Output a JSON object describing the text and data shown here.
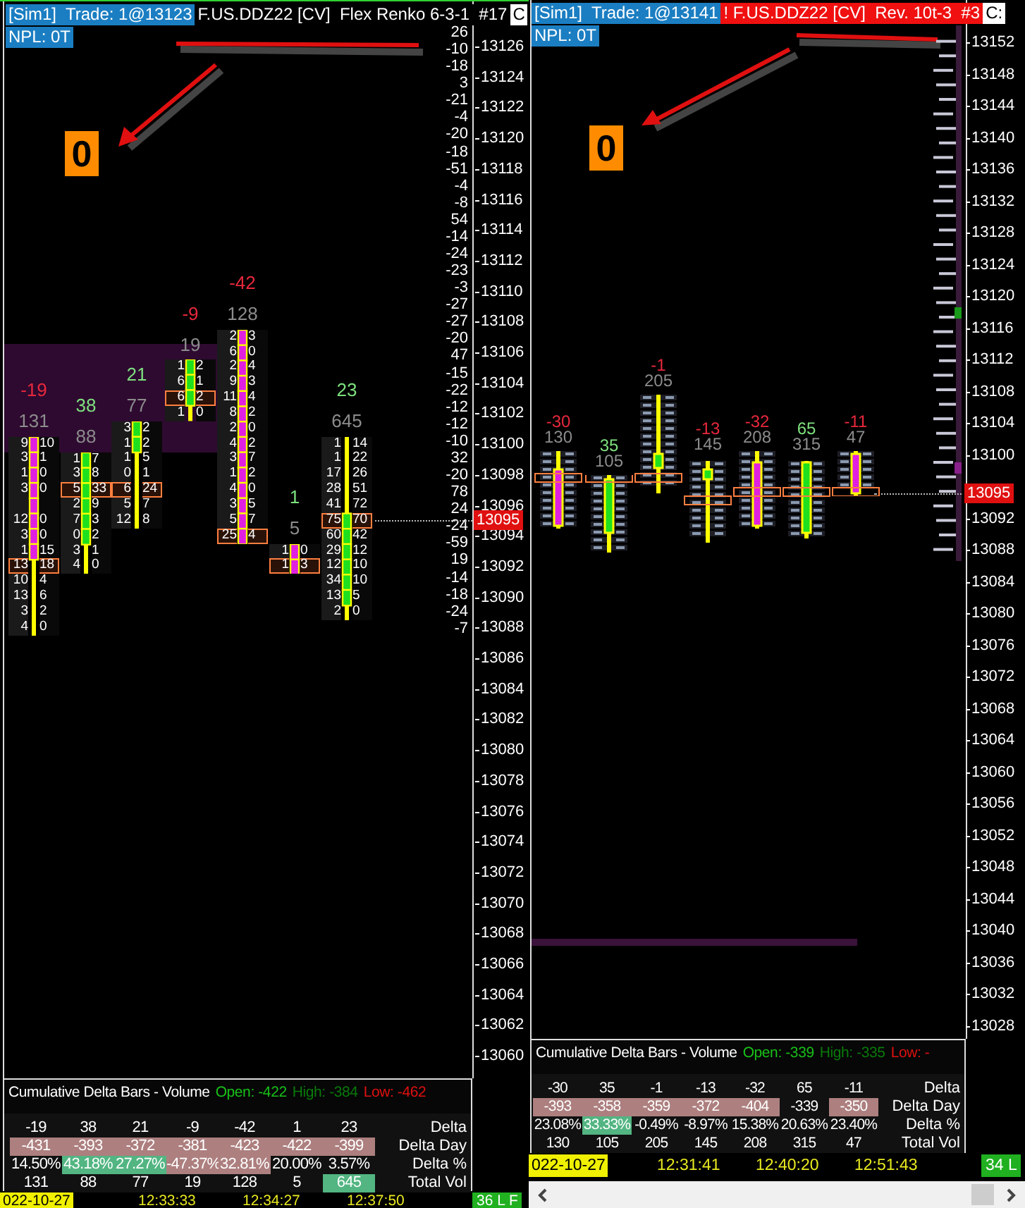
{
  "left": {
    "trade_info": "[Sim1]  Trade: 1@13123",
    "symbol": "F.US.DDZ22 [CV]  Flex Renko 6-3-1  #17",
    "symbol_alert": false,
    "corner": "C",
    "npl": "NPL: 0T",
    "marker": "0",
    "price_axis": [
      "13126",
      "13124",
      "13122",
      "13120",
      "13118",
      "13116",
      "13114",
      "13112",
      "13110",
      "13108",
      "13106",
      "13104",
      "13102",
      "13100",
      "13098",
      "13096",
      "13094",
      "13092",
      "13090",
      "13088",
      "13086",
      "13084",
      "13082",
      "13080",
      "13078",
      "13076",
      "13074",
      "13072",
      "13070",
      "13068",
      "13066",
      "13064",
      "13062",
      "13060"
    ],
    "delta_ladder": [
      "26",
      "-10",
      "-18",
      "3",
      "-21",
      "-4",
      "-20",
      "-18",
      "-51",
      "-4",
      "-8",
      "54",
      "-14",
      "-24",
      "-23",
      "-3",
      "-27",
      "-27",
      "-20",
      "47",
      "-15",
      "-22",
      "-12",
      "-12",
      "-10",
      "32",
      "-20",
      "78",
      "24",
      "-24",
      "-59",
      "19",
      "-14",
      "-18",
      "-24",
      "-7"
    ],
    "current_price": "13095",
    "bars": [
      {
        "delta": "-19",
        "negative": true,
        "volume": "131",
        "bullish": false,
        "rows": [
          {
            "bid": "9",
            "ask": "10",
            "poc": false,
            "body": true
          },
          {
            "bid": "3",
            "ask": "1",
            "poc": false,
            "body": true
          },
          {
            "bid": "1",
            "ask": "0",
            "poc": false,
            "body": true
          },
          {
            "bid": "3",
            "ask": "0",
            "poc": false,
            "body": true
          },
          {
            "poc": false,
            "body": true
          },
          {
            "bid": "12",
            "ask": "0",
            "poc": false,
            "body": true
          },
          {
            "bid": "3",
            "ask": "0",
            "poc": false,
            "body": true
          },
          {
            "bid": "1",
            "ask": "15",
            "poc": false,
            "body": true
          },
          {
            "bid": "13",
            "ask": "18",
            "poc": true,
            "body": false
          },
          {
            "bid": "10",
            "ask": "4",
            "poc": false,
            "body": false
          },
          {
            "bid": "13",
            "ask": "6",
            "poc": false,
            "body": false
          },
          {
            "bid": "3",
            "ask": "2",
            "poc": false,
            "body": false
          },
          {
            "bid": "4",
            "ask": "0",
            "poc": false,
            "body": false
          }
        ]
      },
      {
        "delta": "38",
        "negative": false,
        "volume": "88",
        "bullish": true,
        "rows": [
          {
            "bid": "1",
            "ask": "7",
            "poc": false,
            "body": true
          },
          {
            "bid": "3",
            "ask": "8",
            "poc": false,
            "body": true
          },
          {
            "bid": "5",
            "ask": "33",
            "poc": true,
            "body": true
          },
          {
            "bid": "2",
            "ask": "9",
            "poc": false,
            "body": true
          },
          {
            "bid": "7",
            "ask": "3",
            "poc": false,
            "body": true
          },
          {
            "bid": "0",
            "ask": "2",
            "poc": false,
            "body": true
          },
          {
            "bid": "3",
            "ask": "1",
            "poc": false,
            "body": false
          },
          {
            "bid": "4",
            "ask": "0",
            "poc": false,
            "body": false
          }
        ]
      },
      {
        "delta": "21",
        "negative": false,
        "volume": "77",
        "bullish": true,
        "rows": [
          {
            "bid": "3",
            "ask": "2",
            "poc": false,
            "body": true
          },
          {
            "bid": "1",
            "ask": "2",
            "poc": false,
            "body": true
          },
          {
            "bid": "1",
            "ask": "5",
            "poc": false,
            "body": false
          },
          {
            "bid": "0",
            "ask": "1",
            "poc": false,
            "body": false
          },
          {
            "bid": "6",
            "ask": "24",
            "poc": true,
            "body": false
          },
          {
            "bid": "5",
            "ask": "7",
            "poc": false,
            "body": false
          },
          {
            "bid": "12",
            "ask": "8",
            "poc": false,
            "body": false
          }
        ]
      },
      {
        "delta": "-9",
        "negative": true,
        "volume": "19",
        "bullish": true,
        "rows": [
          {
            "bid": "1",
            "ask": "2",
            "poc": false,
            "body": true
          },
          {
            "bid": "6",
            "ask": "1",
            "poc": false,
            "body": true
          },
          {
            "bid": "6",
            "ask": "2",
            "poc": true,
            "body": true
          },
          {
            "bid": "1",
            "ask": "0",
            "poc": false,
            "body": false
          }
        ]
      },
      {
        "delta": "-42",
        "negative": true,
        "volume": "128",
        "bullish": false,
        "rows": [
          {
            "bid": "2",
            "ask": "3",
            "poc": false,
            "body": true
          },
          {
            "bid": "6",
            "ask": "0",
            "poc": false,
            "body": true
          },
          {
            "bid": "2",
            "ask": "4",
            "poc": false,
            "body": true
          },
          {
            "bid": "9",
            "ask": "3",
            "poc": false,
            "body": true
          },
          {
            "bid": "11",
            "ask": "4",
            "poc": false,
            "body": true
          },
          {
            "bid": "8",
            "ask": "2",
            "poc": false,
            "body": true
          },
          {
            "bid": "2",
            "ask": "0",
            "poc": false,
            "body": true
          },
          {
            "bid": "4",
            "ask": "2",
            "poc": false,
            "body": true
          },
          {
            "bid": "3",
            "ask": "7",
            "poc": false,
            "body": true
          },
          {
            "bid": "1",
            "ask": "2",
            "poc": false,
            "body": true
          },
          {
            "bid": "4",
            "ask": "0",
            "poc": false,
            "body": true
          },
          {
            "bid": "3",
            "ask": "5",
            "poc": false,
            "body": true
          },
          {
            "bid": "5",
            "ask": "7",
            "poc": false,
            "body": true
          },
          {
            "bid": "25",
            "ask": "4",
            "poc": true,
            "body": true
          }
        ]
      },
      {
        "delta": "1",
        "negative": false,
        "volume": "5",
        "bullish": false,
        "rows": [
          {
            "bid": "1",
            "ask": "0",
            "poc": false,
            "body": true
          },
          {
            "bid": "1",
            "ask": "3",
            "poc": true,
            "body": true
          }
        ]
      },
      {
        "delta": "23",
        "negative": false,
        "volume": "645",
        "bullish": true,
        "rows": [
          {
            "bid": "1",
            "ask": "14",
            "poc": false,
            "body": false
          },
          {
            "bid": "1",
            "ask": "22",
            "poc": false,
            "body": false
          },
          {
            "bid": "17",
            "ask": "26",
            "poc": false,
            "body": false
          },
          {
            "bid": "28",
            "ask": "51",
            "poc": false,
            "body": false
          },
          {
            "bid": "41",
            "ask": "72",
            "poc": false,
            "body": false
          },
          {
            "bid": "75",
            "ask": "70",
            "poc": true,
            "body": true
          },
          {
            "bid": "60",
            "ask": "42",
            "poc": false,
            "body": true
          },
          {
            "bid": "29",
            "ask": "12",
            "poc": false,
            "body": true
          },
          {
            "bid": "12",
            "ask": "10",
            "poc": false,
            "body": true
          },
          {
            "bid": "34",
            "ask": "10",
            "poc": false,
            "body": true
          },
          {
            "bid": "13",
            "ask": "5",
            "poc": false,
            "body": true
          },
          {
            "bid": "2",
            "ask": "0",
            "poc": false,
            "body": false
          }
        ]
      }
    ],
    "indicator": {
      "title": "Cumulative Delta Bars - Volume",
      "open": "Open: -422",
      "high": "High: -384",
      "low": "Low: -462"
    },
    "table": [
      {
        "label": "Delta",
        "cells": [
          {
            "text": "-19",
            "gain": false,
            "loss": false
          },
          {
            "text": "38",
            "gain": false,
            "loss": false
          },
          {
            "text": "21",
            "gain": false,
            "loss": false
          },
          {
            "text": "-9",
            "gain": false,
            "loss": false
          },
          {
            "text": "-42",
            "gain": false,
            "loss": false
          },
          {
            "text": "1",
            "gain": false,
            "loss": false
          },
          {
            "text": "23",
            "gain": false,
            "loss": false
          }
        ]
      },
      {
        "label": "Delta Day",
        "cells": [
          {
            "text": "-431",
            "gain": false,
            "loss": true
          },
          {
            "text": "-393",
            "gain": false,
            "loss": true
          },
          {
            "text": "-372",
            "gain": false,
            "loss": true
          },
          {
            "text": "-381",
            "gain": false,
            "loss": true
          },
          {
            "text": "-423",
            "gain": false,
            "loss": true
          },
          {
            "text": "-422",
            "gain": false,
            "loss": true
          },
          {
            "text": "-399",
            "gain": false,
            "loss": true
          }
        ]
      },
      {
        "label": "Delta %",
        "cells": [
          {
            "text": "14.50%",
            "gain": false,
            "loss": false
          },
          {
            "text": "43.18%",
            "gain": true,
            "loss": false
          },
          {
            "text": "27.27%",
            "gain": true,
            "loss": false
          },
          {
            "text": "-47.37%",
            "gain": false,
            "loss": true
          },
          {
            "text": "32.81%",
            "gain": false,
            "loss": true
          },
          {
            "text": "20.00%",
            "gain": false,
            "loss": false
          },
          {
            "text": "3.57%",
            "gain": false,
            "loss": false
          }
        ]
      },
      {
        "label": "Total Vol",
        "cells": [
          {
            "text": "131",
            "gain": false,
            "loss": false
          },
          {
            "text": "88",
            "gain": false,
            "loss": false
          },
          {
            "text": "77",
            "gain": false,
            "loss": false
          },
          {
            "text": "19",
            "gain": false,
            "loss": false
          },
          {
            "text": "128",
            "gain": false,
            "loss": false
          },
          {
            "text": "5",
            "gain": false,
            "loss": false
          },
          {
            "text": "645",
            "gain": true,
            "loss": false
          }
        ]
      }
    ],
    "time_axis": [
      {
        "text": "022-10-27",
        "kind": "date"
      },
      {
        "text": "12:33:33",
        "kind": "time"
      },
      {
        "text": "12:34:27",
        "kind": "time"
      },
      {
        "text": "12:37:50",
        "kind": "time"
      }
    ],
    "status": "36 L F"
  },
  "right": {
    "trade_info": "[Sim1]  Trade: 1@13141",
    "symbol": "! F.US.DDZ22 [CV]  Rev. 10t-3  #3",
    "symbol_alert": true,
    "corner": "C:",
    "npl": "NPL: 0T",
    "marker": "0",
    "price_axis": [
      "13152",
      "13148",
      "13144",
      "13140",
      "13136",
      "13132",
      "13128",
      "13124",
      "13120",
      "13116",
      "13112",
      "13108",
      "13104",
      "13100",
      "13092",
      "13088",
      "13084",
      "13080",
      "13076",
      "13072",
      "13068",
      "13064",
      "13060",
      "13056",
      "13052",
      "13048",
      "13044",
      "13040",
      "13036",
      "13032",
      "13028"
    ],
    "current_price": "13095",
    "bars": [
      {
        "delta": "-30",
        "negative": true,
        "volume": "130",
        "bullish": false
      },
      {
        "delta": "35",
        "negative": false,
        "volume": "105",
        "bullish": true
      },
      {
        "delta": "-1",
        "negative": true,
        "volume": "205",
        "bullish": true
      },
      {
        "delta": "-13",
        "negative": true,
        "volume": "145",
        "bullish": true
      },
      {
        "delta": "-32",
        "negative": true,
        "volume": "208",
        "bullish": false
      },
      {
        "delta": "65",
        "negative": false,
        "volume": "315",
        "bullish": true
      },
      {
        "delta": "-11",
        "negative": true,
        "volume": "47",
        "bullish": false
      }
    ],
    "indicator": {
      "title": "Cumulative Delta Bars - Volume",
      "open": "Open: -339",
      "high": "High: -335",
      "low": "Low: -"
    },
    "table": [
      {
        "label": "Delta",
        "cells": [
          {
            "text": "-30",
            "gain": false,
            "loss": false
          },
          {
            "text": "35",
            "gain": false,
            "loss": false
          },
          {
            "text": "-1",
            "gain": false,
            "loss": false
          },
          {
            "text": "-13",
            "gain": false,
            "loss": false
          },
          {
            "text": "-32",
            "gain": false,
            "loss": false
          },
          {
            "text": "65",
            "gain": false,
            "loss": false
          },
          {
            "text": "-11",
            "gain": false,
            "loss": false
          }
        ]
      },
      {
        "label": "Delta Day",
        "cells": [
          {
            "text": "-393",
            "gain": false,
            "loss": true
          },
          {
            "text": "-358",
            "gain": false,
            "loss": true
          },
          {
            "text": "-359",
            "gain": false,
            "loss": true
          },
          {
            "text": "-372",
            "gain": false,
            "loss": true
          },
          {
            "text": "-404",
            "gain": false,
            "loss": true
          },
          {
            "text": "-339",
            "gain": false,
            "loss": false
          },
          {
            "text": "-350",
            "gain": false,
            "loss": true
          }
        ]
      },
      {
        "label": "Delta %",
        "cells": [
          {
            "text": "23.08%",
            "gain": false,
            "loss": false
          },
          {
            "text": "33.33%",
            "gain": true,
            "loss": false
          },
          {
            "text": "-0.49%",
            "gain": false,
            "loss": false
          },
          {
            "text": "-8.97%",
            "gain": false,
            "loss": false
          },
          {
            "text": "15.38%",
            "gain": false,
            "loss": false
          },
          {
            "text": "20.63%",
            "gain": false,
            "loss": false
          },
          {
            "text": "23.40%",
            "gain": false,
            "loss": false
          }
        ]
      },
      {
        "label": "Total Vol",
        "cells": [
          {
            "text": "130",
            "gain": false,
            "loss": false
          },
          {
            "text": "105",
            "gain": false,
            "loss": false
          },
          {
            "text": "205",
            "gain": false,
            "loss": false
          },
          {
            "text": "145",
            "gain": false,
            "loss": false
          },
          {
            "text": "208",
            "gain": false,
            "loss": false
          },
          {
            "text": "315",
            "gain": false,
            "loss": false
          },
          {
            "text": "47",
            "gain": false,
            "loss": false
          }
        ]
      }
    ],
    "time_axis": [
      {
        "text": "022-10-27",
        "kind": "date"
      },
      {
        "text": "12:31:41",
        "kind": "time"
      },
      {
        "text": "12:40:20",
        "kind": "time"
      },
      {
        "text": "12:51:43",
        "kind": "time"
      }
    ],
    "status": "34 L"
  }
}
